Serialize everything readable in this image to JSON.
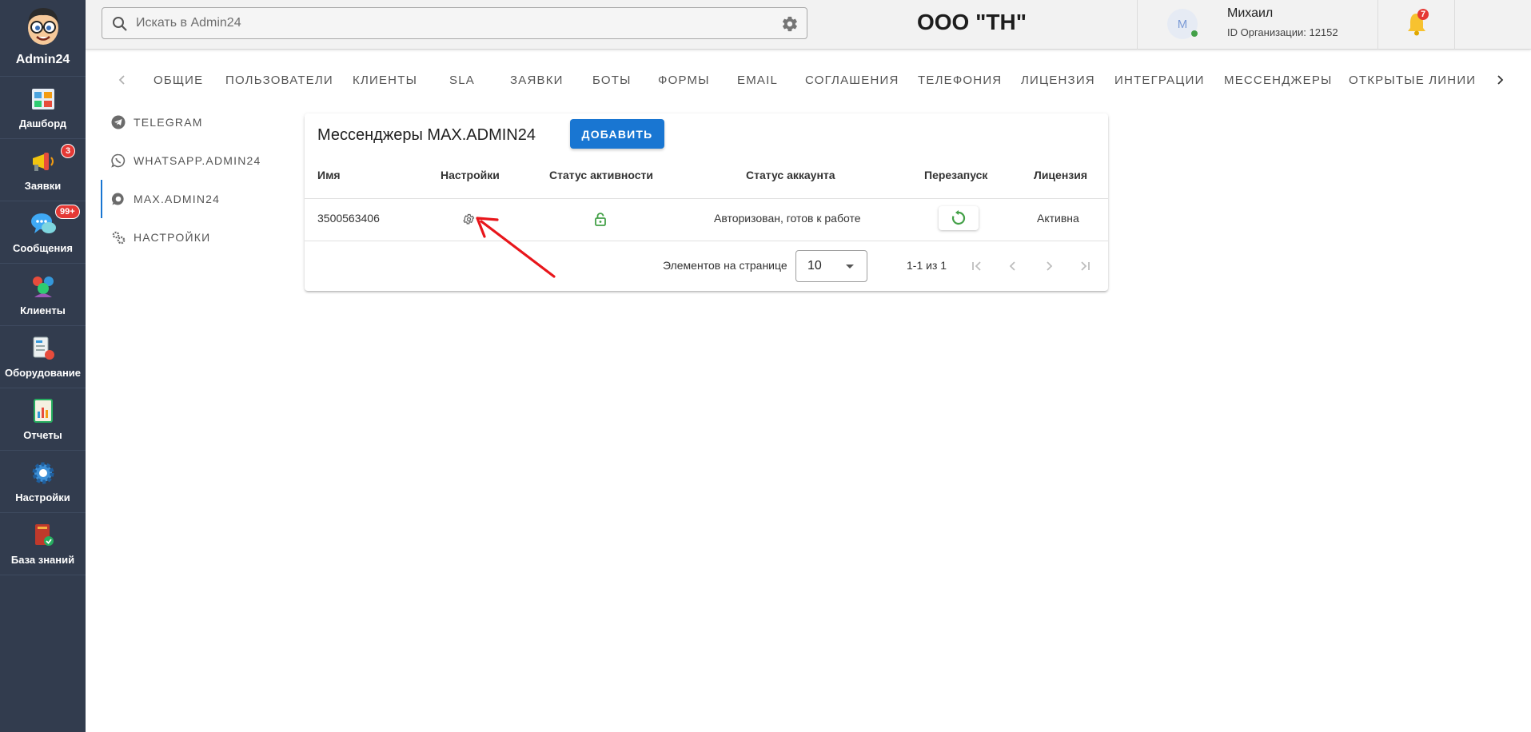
{
  "app": {
    "name": "Admin24"
  },
  "rail": [
    {
      "label": "Дашборд",
      "icon": "dashboard-icon"
    },
    {
      "label": "Заявки",
      "icon": "megaphone-icon",
      "badge": "3"
    },
    {
      "label": "Сообщения",
      "icon": "chat-bubbles-icon",
      "badge": "99+"
    },
    {
      "label": "Клиенты",
      "icon": "clients-icon"
    },
    {
      "label": "Оборудование",
      "icon": "equipment-icon"
    },
    {
      "label": "Отчеты",
      "icon": "reports-icon"
    },
    {
      "label": "Настройки",
      "icon": "settings-gear-icon"
    },
    {
      "label": "База знаний",
      "icon": "knowledge-book-icon"
    }
  ],
  "header": {
    "search_placeholder": "Искать в Admin24",
    "org_name": "ООО \"ТН\"",
    "user": {
      "initial": "М",
      "name": "Михаил",
      "org_id": "ID Организации: 12152"
    },
    "notifications_count": "7"
  },
  "tabs": [
    "ОБЩИЕ",
    "ПОЛЬЗОВАТЕЛИ",
    "КЛИЕНТЫ",
    "SLA",
    "ЗАЯВКИ",
    "БОТЫ",
    "ФОРМЫ",
    "EMAIL",
    "СОГЛАШЕНИЯ",
    "ТЕЛЕФОНИЯ",
    "ЛИЦЕНЗИЯ",
    "ИНТЕГРАЦИИ",
    "МЕССЕНДЖЕРЫ",
    "ОТКРЫТЫЕ ЛИНИИ"
  ],
  "subnav": [
    {
      "label": "TELEGRAM",
      "icon": "telegram-icon"
    },
    {
      "label": "WHATSAPP.ADMIN24",
      "icon": "whatsapp-icon"
    },
    {
      "label": "MAX.ADMIN24",
      "icon": "max-chat-icon",
      "active": true
    },
    {
      "label": "НАСТРОЙКИ",
      "icon": "settings-cogs-icon"
    }
  ],
  "card": {
    "title": "Мессенджеры MAX.ADMIN24",
    "add_label": "ДОБАВИТЬ",
    "columns": [
      "Имя",
      "Настройки",
      "Статус активности",
      "Статус аккаунта",
      "Перезапуск",
      "Лицензия"
    ],
    "rows": [
      {
        "name": "3500563406",
        "account_status": "Авторизован, готов к работе",
        "license": "Активна",
        "activity": "unlocked"
      }
    ],
    "pager": {
      "label": "Элементов на странице",
      "per_page": "10",
      "range": "1-1 из 1"
    }
  },
  "colors": {
    "rail_bg": "#323c4e",
    "primary": "#1976d2",
    "success": "#43a047",
    "badge": "#e53935",
    "annotation": "#e8161b"
  }
}
